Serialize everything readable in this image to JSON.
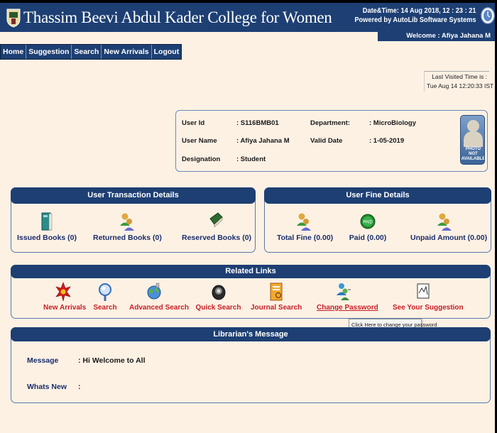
{
  "header": {
    "college_name": "Thassim Beevi Abdul Kader College for Women",
    "datetime": "Date&Time:  14 Aug 2018, 12 : 23 : 21",
    "powered_by": "Powered by AutoLib Software Systems",
    "welcome": "Welcome  :  Afiya Jahana M"
  },
  "nav": {
    "items": [
      "Home",
      "Suggestion",
      "Search",
      "New Arrivals",
      "Logout"
    ]
  },
  "last_visit": {
    "label": "Last Visited Time is :",
    "value": "Tue Aug 14 12:20:33 IST 2018"
  },
  "profile": {
    "user_id_label": "User Id",
    "user_id": ": S116BMB01",
    "user_name_label": "User Name",
    "user_name": ": Afiya Jahana M",
    "designation_label": "Designation",
    "designation": ": Student",
    "department_label": "Department:",
    "department": ": MicroBiology",
    "valid_date_label": "Valid Date",
    "valid_date": ": 1-05-2019",
    "photo_text": "PHOTO NOT AVAILABLE"
  },
  "transactions": {
    "title": "User Transaction Details",
    "items": [
      "Issued Books (0)",
      "Returned Books (0)",
      "Reserved Books (0)"
    ]
  },
  "fines": {
    "title": "User Fine Details",
    "items": [
      "Total Fine (0.00)",
      "Paid (0.00)",
      "Unpaid Amount (0.00)"
    ]
  },
  "related": {
    "title": "Related Links",
    "items": [
      "New Arrivals",
      "Search",
      "Advanced Search",
      "Quick Search",
      "Journal Search",
      "Change Password",
      "See Your Suggestion"
    ],
    "tooltip": "Click Here to change your password"
  },
  "librarian": {
    "title": "Librarian's Message",
    "message_label": "Message",
    "message": ": Hi Welcome to All",
    "whats_new_label": "Whats New",
    "whats_new": ":"
  },
  "colors": {
    "navy": "#1d3f73",
    "background": "#fdf1e4",
    "link_red": "#c81d24",
    "label_blue": "#1a2d6b"
  },
  "icons": {
    "transactions": [
      "teal-book-icon",
      "people-icon",
      "green-book-icon"
    ],
    "fines": [
      "people-icon",
      "green-badge-icon",
      "people-icon"
    ],
    "related": [
      "red-star-icon",
      "magnifier-icon",
      "globe-icon",
      "camera-icon",
      "journal-icon",
      "people-key-icon",
      "chart-icon"
    ]
  }
}
